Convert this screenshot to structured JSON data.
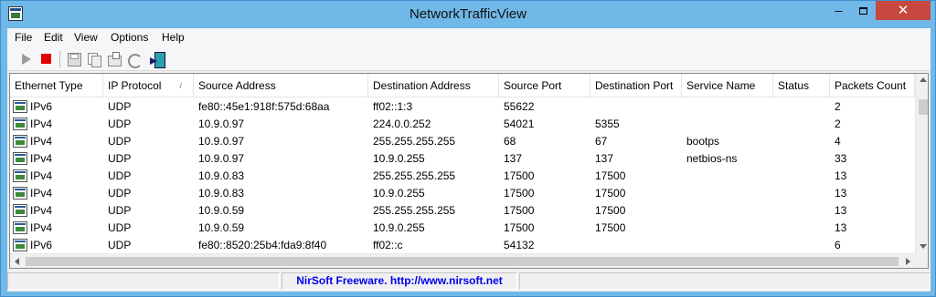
{
  "window": {
    "title": "NetworkTrafficView",
    "min": "–",
    "close": "✕"
  },
  "menu": [
    "File",
    "Edit",
    "View",
    "Options",
    "Help"
  ],
  "toolbar": [
    "play-icon",
    "stop-icon",
    "save-icon",
    "copy-icon",
    "properties-icon",
    "refresh-icon",
    "exit-icon"
  ],
  "columns": [
    "Ethernet Type",
    "IP Protocol",
    "Source Address",
    "Destination Address",
    "Source Port",
    "Destination Port",
    "Service Name",
    "Status",
    "Packets Count"
  ],
  "sort_indicator": "/",
  "rows": [
    [
      "IPv6",
      "UDP",
      "fe80::45e1:918f:575d:68aa",
      "ff02::1:3",
      "55622",
      "",
      "",
      "",
      "2"
    ],
    [
      "IPv4",
      "UDP",
      "10.9.0.97",
      "224.0.0.252",
      "54021",
      "5355",
      "",
      "",
      "2"
    ],
    [
      "IPv4",
      "UDP",
      "10.9.0.97",
      "255.255.255.255",
      "68",
      "67",
      "bootps",
      "",
      "4"
    ],
    [
      "IPv4",
      "UDP",
      "10.9.0.97",
      "10.9.0.255",
      "137",
      "137",
      "netbios-ns",
      "",
      "33"
    ],
    [
      "IPv4",
      "UDP",
      "10.9.0.83",
      "255.255.255.255",
      "17500",
      "17500",
      "",
      "",
      "13"
    ],
    [
      "IPv4",
      "UDP",
      "10.9.0.83",
      "10.9.0.255",
      "17500",
      "17500",
      "",
      "",
      "13"
    ],
    [
      "IPv4",
      "UDP",
      "10.9.0.59",
      "255.255.255.255",
      "17500",
      "17500",
      "",
      "",
      "13"
    ],
    [
      "IPv4",
      "UDP",
      "10.9.0.59",
      "10.9.0.255",
      "17500",
      "17500",
      "",
      "",
      "13"
    ],
    [
      "IPv6",
      "UDP",
      "fe80::8520:25b4:fda9:8f40",
      "ff02::c",
      "54132",
      "",
      "",
      "",
      "6"
    ]
  ],
  "status": {
    "text": "NirSoft Freeware.  http://www.nirsoft.net",
    "link_color": "#0000ee"
  }
}
